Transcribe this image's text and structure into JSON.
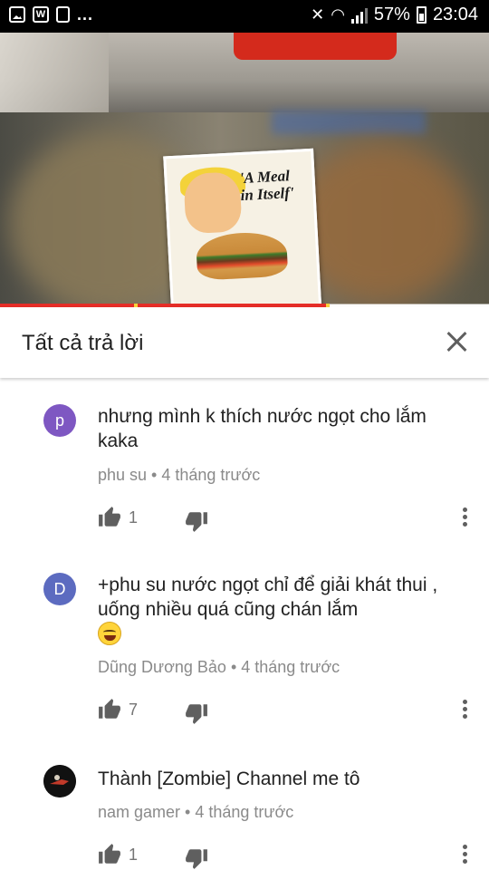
{
  "status_bar": {
    "left_icons": [
      "image-icon",
      "w-app-icon",
      "document-icon"
    ],
    "overflow": "...",
    "battery": "57%",
    "time": "23:04"
  },
  "video": {
    "poster_text": "'A Meal in Itself'",
    "progress": 0.67
  },
  "header": {
    "title": "Tất cả trả lời"
  },
  "comments": [
    {
      "avatar_letter": "p",
      "avatar_color": "#7e57c2",
      "text": "nhưng mình k thích nước ngọt cho lắm kaka",
      "author": "phu su",
      "time": "4 tháng trước",
      "likes": "1"
    },
    {
      "avatar_letter": "D",
      "avatar_color": "#5c6bc0",
      "text": "+phu su nước ngọt chỉ để giải khát thui , uống nhiều quá cũng chán lắm",
      "emoji": "grinning-sweat-emoji",
      "author": "Dũng Dương Bảo",
      "time": "4 tháng trước",
      "likes": "7"
    },
    {
      "avatar_letter": "",
      "avatar_color": "#111111",
      "text": "Thành [Zombie] Channel me tô",
      "author": "nam gamer",
      "time": "4 tháng trước",
      "likes": "1"
    }
  ],
  "colors": {
    "progress": "#e52d27",
    "meta_text": "#8a8a8a",
    "icon": "#5f5f5f"
  }
}
